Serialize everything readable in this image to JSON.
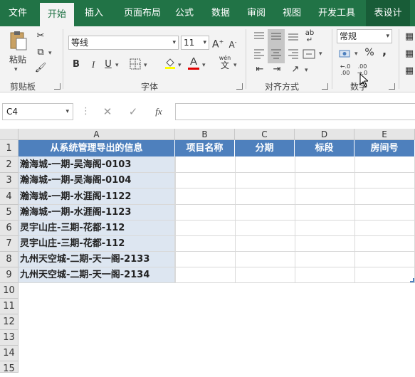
{
  "tabs": [
    "文件",
    "开始",
    "插入",
    "页面布局",
    "公式",
    "数据",
    "审阅",
    "视图",
    "开发工具",
    "表设计"
  ],
  "clipboard": {
    "paste": "粘贴",
    "label": "剪贴板"
  },
  "font": {
    "name": "等线",
    "size": "11",
    "bold": "B",
    "italic": "I",
    "underline": "U",
    "label": "字体",
    "font_color_glyph": "A",
    "phonetic": "wén"
  },
  "alignment": {
    "label": "对齐方式"
  },
  "number": {
    "format": "常规",
    "label": "数字",
    "percent": "%",
    "comma": ","
  },
  "namebox": "C4",
  "formula_bar": {
    "fx": "fx",
    "value": ""
  },
  "columns": [
    "A",
    "B",
    "C",
    "D",
    "E"
  ],
  "rows": [
    "1",
    "2",
    "3",
    "4",
    "5",
    "6",
    "7",
    "8",
    "9",
    "10",
    "11",
    "12",
    "13",
    "14",
    "15"
  ],
  "table": {
    "headers": [
      "从系统管理导出的信息",
      "项目名称",
      "分期",
      "标段",
      "房间号"
    ],
    "data": [
      "瀚海城-一期-吴海阁-0103",
      "瀚海城-一期-吴海阁-0104",
      "瀚海城-一期-水涯阁-1122",
      "瀚海城-一期-水涯阁-1123",
      "灵宇山庄-三期-花都-112",
      "灵宇山庄-三期-花都-112",
      "九州天空城-二期-天一阁-2133",
      "九州天空城-二期-天一阁-2134"
    ]
  },
  "colors": {
    "brand": "#217346",
    "table_header": "#4e80bd",
    "table_col_a": "#dde6f1",
    "font_color": "#e00000"
  }
}
